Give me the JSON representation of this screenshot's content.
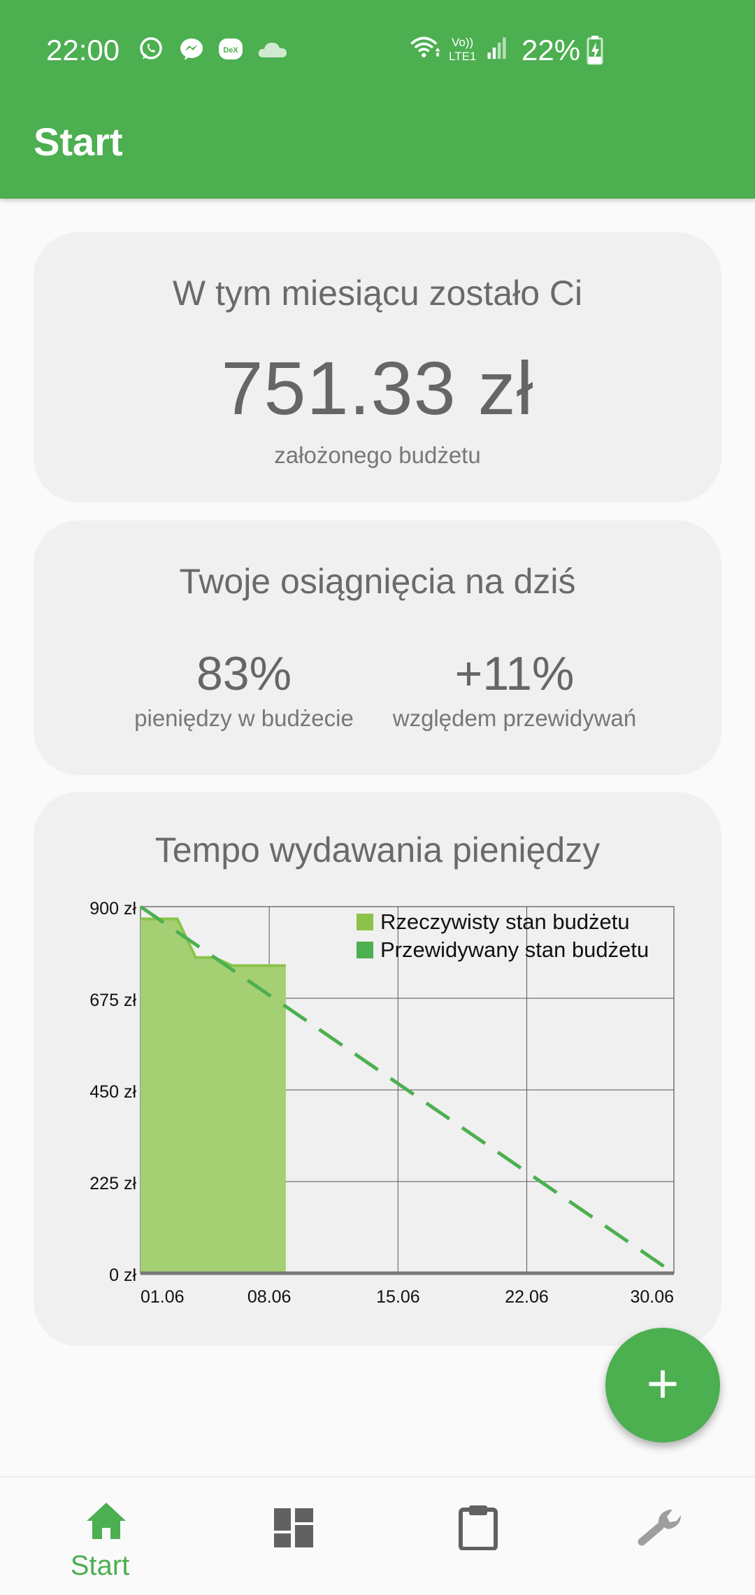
{
  "status_bar": {
    "time": "22:00",
    "notification_icons": [
      "whatsapp-icon",
      "messenger-icon",
      "dex-icon",
      "cloud-icon"
    ],
    "dex_label": "DeX",
    "network_label_top": "Vo))",
    "network_label_bottom": "LTE1",
    "battery_percent": "22%"
  },
  "app_bar": {
    "title": "Start"
  },
  "budget_card": {
    "title": "W tym miesiącu zostało Ci",
    "amount": "751.33 zł",
    "subtitle": "założonego budżetu"
  },
  "stats_card": {
    "title": "Twoje osiągnięcia na dziś",
    "left_value": "83%",
    "left_label": "pieniędzy w budżecie",
    "right_value": "+11%",
    "right_label": "względem przewidywań"
  },
  "chart_card": {
    "title": "Tempo wydawania pieniędzy"
  },
  "chart_data": {
    "type": "area",
    "x_ticks": [
      "01.06",
      "08.06",
      "15.06",
      "22.06",
      "30.06"
    ],
    "x_tick_days": [
      1,
      8,
      15,
      22,
      30
    ],
    "xlim": [
      1,
      30
    ],
    "y_ticks": [
      "0 zł",
      "225 zł",
      "450 zł",
      "675 zł",
      "900 zł"
    ],
    "y_tick_values": [
      0,
      225,
      450,
      675,
      900
    ],
    "ylim": [
      0,
      900
    ],
    "grid": true,
    "legend_position": "top-right",
    "series": [
      {
        "name": "Rzeczywisty stan budżetu",
        "type": "area",
        "color": "#8bc34a",
        "x": [
          1,
          2,
          3,
          4,
          5,
          6,
          7,
          8,
          8.9
        ],
        "y": [
          870,
          870,
          870,
          775,
          775,
          755,
          755,
          755,
          755
        ]
      },
      {
        "name": "Przewidywany stan budżetu",
        "type": "line",
        "style": "dashed",
        "color": "#4caf50",
        "x": [
          1,
          30
        ],
        "y": [
          900,
          0
        ]
      }
    ]
  },
  "fab": {
    "label": "+"
  },
  "bottom_nav": {
    "items": [
      {
        "label": "Start",
        "icon": "home-icon",
        "active": true
      },
      {
        "label": "",
        "icon": "dashboard-icon",
        "active": false
      },
      {
        "label": "",
        "icon": "clipboard-icon",
        "active": false
      },
      {
        "label": "",
        "icon": "wrench-icon",
        "active": false
      }
    ]
  },
  "colors": {
    "primary": "#4caf50",
    "actual_fill": "#8bc34a",
    "card_bg": "#f0f0f0",
    "text": "#666666"
  }
}
